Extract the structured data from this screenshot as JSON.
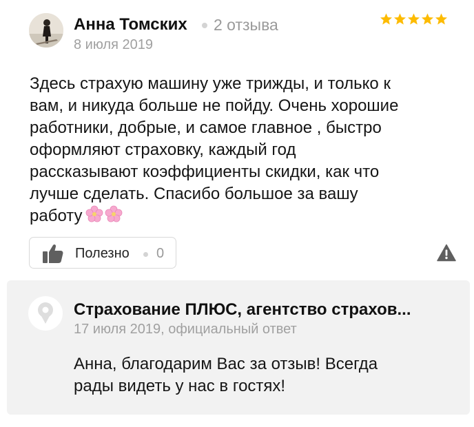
{
  "review": {
    "author": "Анна Томских",
    "reviews_count": "2 отзыва",
    "date": "8 июля 2019",
    "rating": 5,
    "max_rating": 5,
    "star_color": "#fdbb00",
    "text": "Здесь страхую машину уже трижды, и только к\nвам, и никуда больше не пойду. Очень хорошие\nработники, добрые, и самое главное , быстро\nоформляют страховку, каждый год\nрассказывают коэффициенты скидки, как что\nлучше сделать. Спасибо большое за вашу\nработу",
    "emoji": "🌸🌸"
  },
  "actions": {
    "helpful_label": "Полезно",
    "helpful_count": "0",
    "report_icon": "warning-icon",
    "like_icon": "thumbs-up-icon"
  },
  "reply": {
    "org_name": "Страхование ПЛЮС, агентство страхов...",
    "date": "17 июля 2019, официальный ответ",
    "text": "Анна, благодарим Вас за отзыв! Всегда\nрады видеть у нас в гостях!"
  }
}
